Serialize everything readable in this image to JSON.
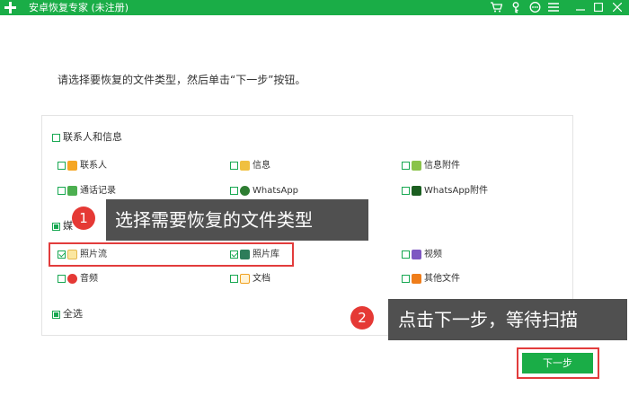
{
  "window": {
    "title": "安卓恢复专家 (未注册)",
    "icons": [
      "cart-icon",
      "key-icon",
      "chat-icon",
      "menu-icon",
      "minimize-icon",
      "maximize-icon",
      "close-icon"
    ]
  },
  "instruction": "请选择要恢复的文件类型，然后单击“下一步”按钮。",
  "groups": {
    "contacts_messages": {
      "label": "联系人和信息",
      "items": {
        "contacts": "联系人",
        "sms": "信息",
        "sms_attachments": "信息附件",
        "call_log": "通话记录",
        "whatsapp": "WhatsApp",
        "whatsapp_attachments": "WhatsApp附件"
      }
    },
    "media": {
      "label": "媒",
      "items": {
        "photo_stream": "照片流",
        "gallery": "照片库",
        "video": "视频",
        "audio": "音频",
        "documents": "文档",
        "other_files": "其他文件"
      }
    },
    "select_all": "全选"
  },
  "annotations": {
    "step1": {
      "number": "1",
      "text": "选择需要恢复的文件类型"
    },
    "step2": {
      "number": "2",
      "text": "点击下一步，等待扫描"
    }
  },
  "next_button": "下一步",
  "colors": {
    "accent": "#1aad47",
    "highlight": "#e23c3c",
    "callout": "#505050"
  }
}
